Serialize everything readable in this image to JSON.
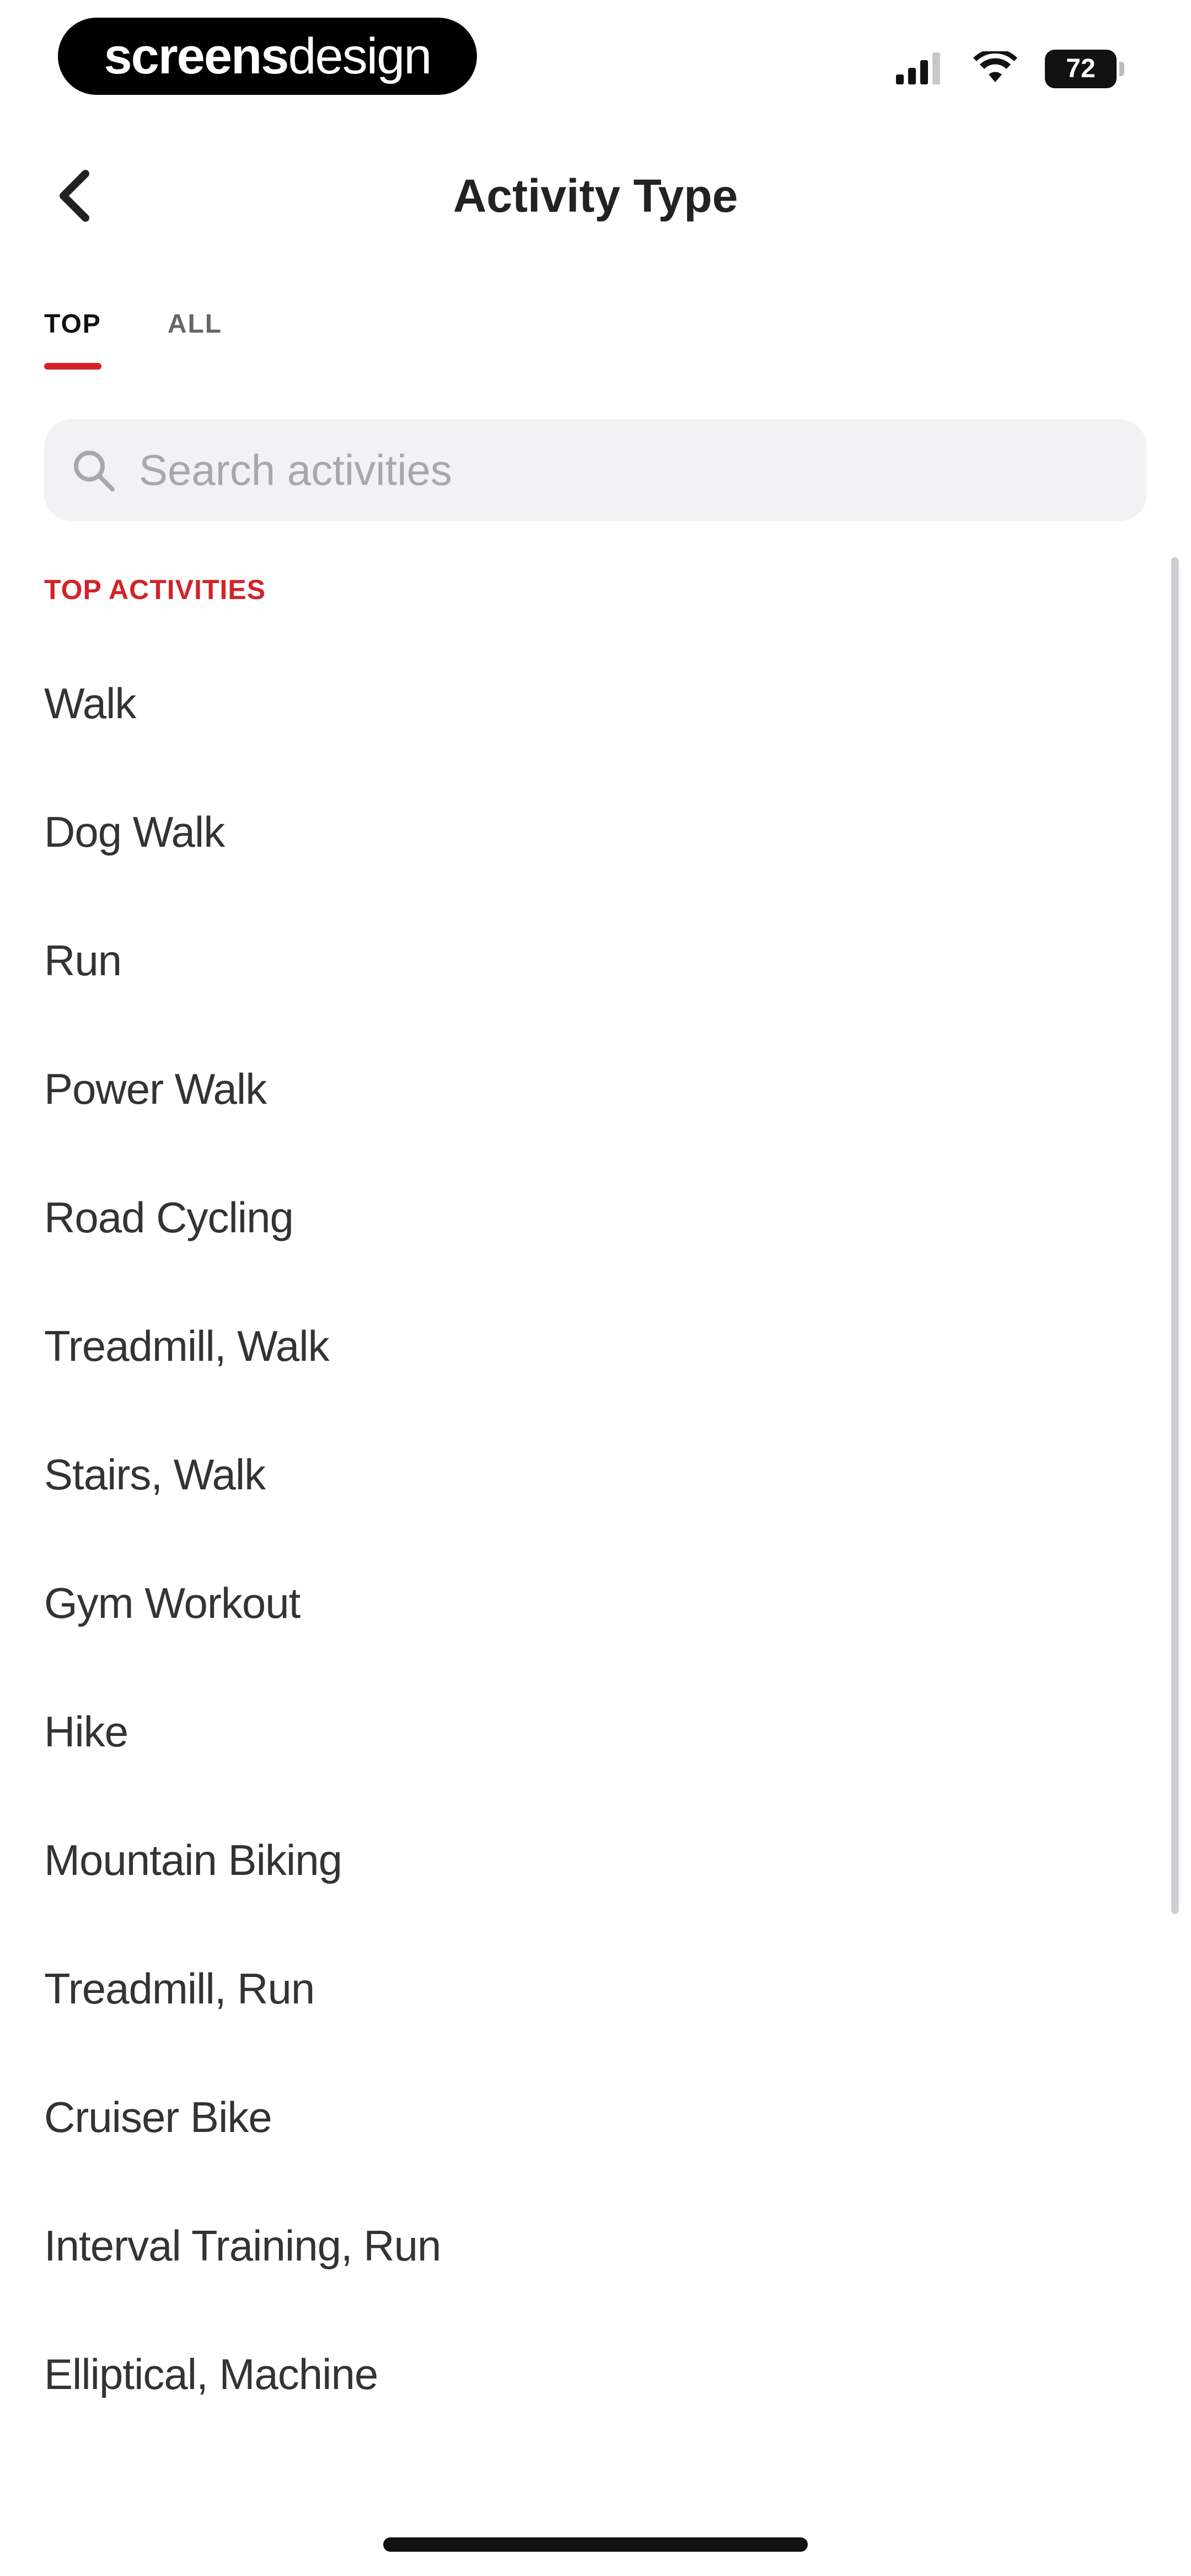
{
  "status_bar": {
    "brand_bold": "screens",
    "brand_light": "design",
    "battery_level": "72",
    "icons": [
      "signal-icon",
      "wifi-icon",
      "battery-icon"
    ]
  },
  "header": {
    "title": "Activity Type",
    "back_icon": "chevron-left-icon"
  },
  "tabs": [
    {
      "label": "TOP",
      "active": true
    },
    {
      "label": "ALL",
      "active": false
    }
  ],
  "search": {
    "placeholder": "Search activities",
    "value": "",
    "icon": "search-icon"
  },
  "section": {
    "title": "TOP ACTIVITIES"
  },
  "activities": [
    {
      "label": "Walk"
    },
    {
      "label": "Dog Walk"
    },
    {
      "label": "Run"
    },
    {
      "label": "Power Walk"
    },
    {
      "label": "Road Cycling"
    },
    {
      "label": "Treadmill, Walk"
    },
    {
      "label": "Stairs, Walk"
    },
    {
      "label": "Gym Workout"
    },
    {
      "label": "Hike"
    },
    {
      "label": "Mountain Biking"
    },
    {
      "label": "Treadmill, Run"
    },
    {
      "label": "Cruiser Bike"
    },
    {
      "label": "Interval Training, Run"
    },
    {
      "label": "Elliptical, Machine"
    }
  ],
  "colors": {
    "accent": "#d2232a",
    "text": "#333333",
    "search_bg": "#f2f2f4",
    "placeholder": "#a7a7ad"
  }
}
